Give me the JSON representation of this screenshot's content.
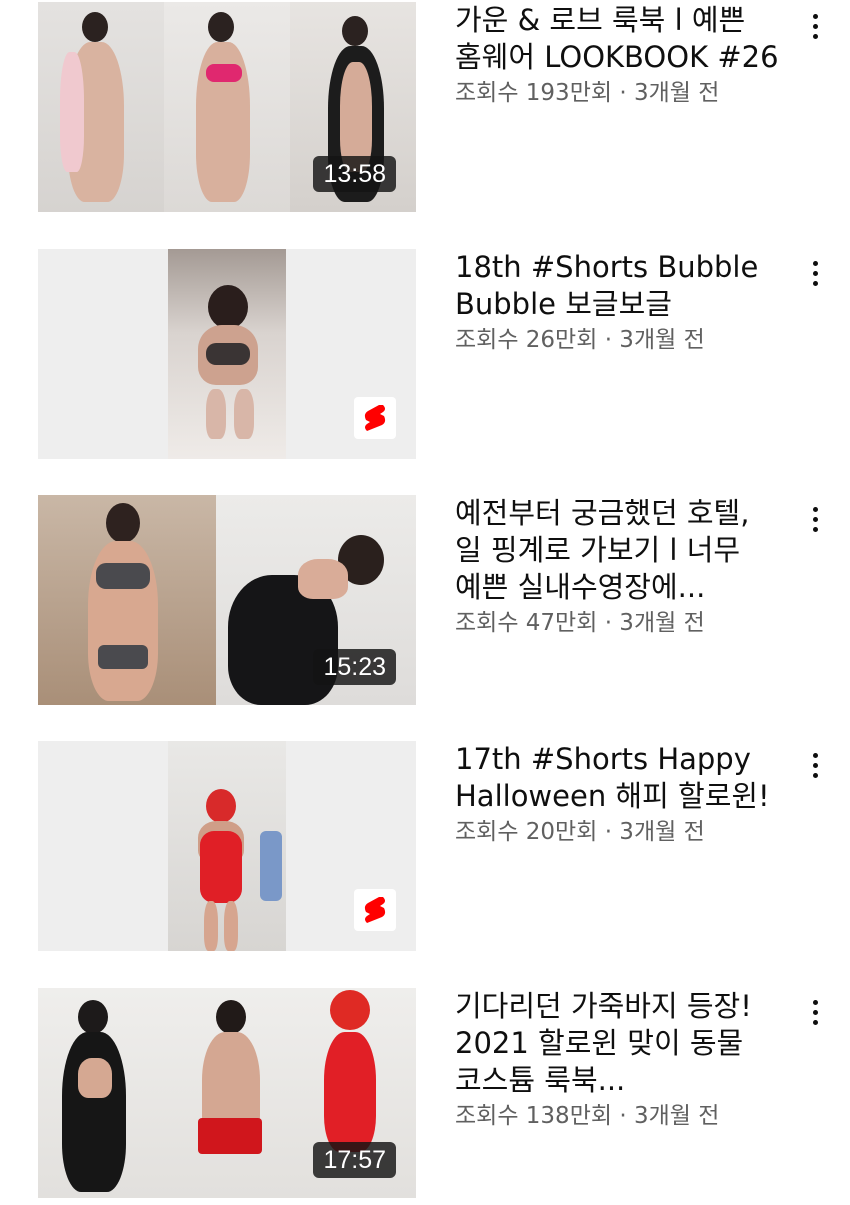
{
  "videos": [
    {
      "title": "가운 & 로브 룩북 l 예쁜 홈웨어 LOOKBOOK #26",
      "meta": "조회수 193만회 · 3개월 전",
      "duration": "13:58",
      "is_short": false
    },
    {
      "title": "18th #Shorts Bubble Bubble 보글보글",
      "meta": "조회수 26만회 · 3개월 전",
      "duration": "",
      "is_short": true
    },
    {
      "title": "예전부터 궁금했던 호텔, 일 핑계로 가보기 l 너무 예쁜 실내수영장에...",
      "meta": "조회수 47만회 · 3개월 전",
      "duration": "15:23",
      "is_short": false
    },
    {
      "title": "17th #Shorts Happy Halloween 해피 할로윈!",
      "meta": "조회수 20만회 · 3개월 전",
      "duration": "",
      "is_short": true
    },
    {
      "title": "기다리던 가죽바지 등장! 2021 할로윈 맞이 동물 코스튬 룩북...",
      "meta": "조회수 138만회 · 3개월 전",
      "duration": "17:57",
      "is_short": false
    }
  ],
  "icons": {
    "more": "more-vertical-icon",
    "shorts": "shorts-logo-icon"
  },
  "colors": {
    "shorts_red": "#ff0000",
    "meta_gray": "#606060",
    "title_black": "#0f0f0f"
  }
}
